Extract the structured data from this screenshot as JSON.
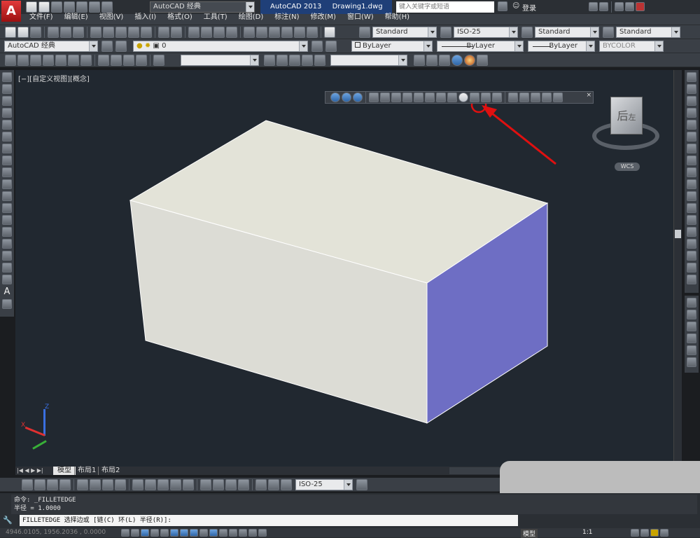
{
  "titlebar": {
    "workspace": "AutoCAD 经典",
    "app_name": "AutoCAD 2013",
    "file_name": "Drawing1.dwg",
    "search_placeholder": "键入关键字或短语",
    "login": "登录"
  },
  "menu": [
    "文件(F)",
    "编辑(E)",
    "视图(V)",
    "插入(I)",
    "格式(O)",
    "工具(T)",
    "绘图(D)",
    "标注(N)",
    "修改(M)",
    "窗口(W)",
    "帮助(H)"
  ],
  "styles": {
    "text_style": "Standard",
    "dim_style": "ISO-25",
    "table_style": "Standard",
    "multileader_style": "Standard"
  },
  "layers": {
    "workspace": "AutoCAD 经典",
    "current_layer": "0",
    "color": "ByLayer",
    "linetype": "ByLayer",
    "lineweight": "ByLayer",
    "plotstyle": "BYCOLOR"
  },
  "viewport": {
    "label": "[−][自定义视图][概念]",
    "viewcube_label": "后",
    "viewcube_side": "左",
    "wcs": "WCS",
    "ucs_z": "Z",
    "ucs_x": "X",
    "box_top_color": "#e3e3d8",
    "box_front_color": "#dcdcd5",
    "box_side_color": "#6e6ec4",
    "annotation_color": "#e01010"
  },
  "layout_tabs": [
    "模型",
    "布局1",
    "布局2"
  ],
  "dim_toolbar": {
    "dim_style": "ISO-25"
  },
  "command": {
    "history_1": "命令: _FILLETEDGE",
    "history_2": "半径 = 1.0000",
    "prompt": "FILLETEDGE 选择边或 [链(C) 环(L) 半径(R)]:"
  },
  "status": {
    "coords": "4946.0105, 1956.2036 , 0.0000",
    "model": "模型",
    "scale": "1:1"
  }
}
